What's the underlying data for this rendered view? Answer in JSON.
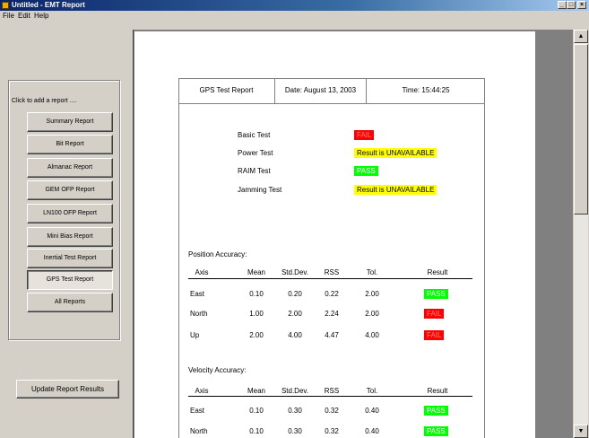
{
  "window": {
    "title": "Untitled - EMT Report",
    "minimize": "_",
    "maximize": "□",
    "close": "×"
  },
  "menu": [
    "File",
    "Edit",
    "Help"
  ],
  "left_panel": {
    "group_label": "Click to add a report ....",
    "buttons": [
      "Summary Report",
      "Bit Report",
      "Almanac Report",
      "GEM OFP Report",
      "LN100 OFP Report",
      "Mini Bias Report",
      "Inertial Test Report",
      "GPS Test Report",
      "All Reports"
    ],
    "selected": "GPS Test Report",
    "update_button": "Update Report Results"
  },
  "report": {
    "title": "GPS Test Report",
    "date": "Date:  August 13, 2003",
    "time": "Time:  15:44:25",
    "tests": [
      {
        "name": "Basic Test",
        "result": "FAIL",
        "status": "fail"
      },
      {
        "name": "Power Test",
        "result": "Result is UNAVAILABLE",
        "status": "unavail"
      },
      {
        "name": "RAIM Test",
        "result": "PASS",
        "status": "pass"
      },
      {
        "name": "Jamming Test",
        "result": "Result is UNAVAILABLE",
        "status": "unavail"
      }
    ],
    "columns": [
      "Axis",
      "Mean",
      "Std.Dev.",
      "RSS",
      "Tol.",
      "Result"
    ],
    "position": {
      "label": "Position Accuracy:",
      "rows": [
        {
          "axis": "East",
          "mean": "0.10",
          "std": "0.20",
          "rss": "0.22",
          "tol": "2.00",
          "result": "PASS",
          "status": "pass"
        },
        {
          "axis": "North",
          "mean": "1.00",
          "std": "2.00",
          "rss": "2.24",
          "tol": "2.00",
          "result": "FAIL",
          "status": "fail"
        },
        {
          "axis": "Up",
          "mean": "2.00",
          "std": "4.00",
          "rss": "4.47",
          "tol": "4.00",
          "result": "FAIL",
          "status": "fail"
        }
      ]
    },
    "velocity": {
      "label": "Velocity Accuracy:",
      "rows": [
        {
          "axis": "East",
          "mean": "0.10",
          "std": "0.30",
          "rss": "0.32",
          "tol": "0.40",
          "result": "PASS",
          "status": "pass"
        },
        {
          "axis": "North",
          "mean": "0.10",
          "std": "0.30",
          "rss": "0.32",
          "tol": "0.40",
          "result": "PASS",
          "status": "pass"
        }
      ]
    }
  }
}
